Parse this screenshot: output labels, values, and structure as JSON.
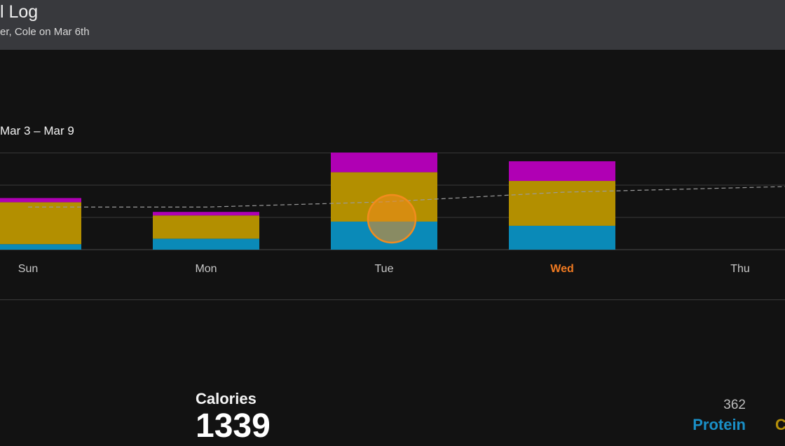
{
  "header": {
    "title": "l Log",
    "subtitle": "er, Cole on Mar 6th"
  },
  "week": {
    "range_label": "Mar 3 – Mar 9"
  },
  "colors": {
    "protein": "#0a8ab8",
    "carbs": "#b38f00",
    "fat": "#b000b4",
    "today": "#f07a21",
    "trend": "#9a9a9a",
    "selection": "#f28c1e"
  },
  "chart_data": {
    "type": "bar",
    "stacked": true,
    "categories": [
      "Sun",
      "Mon",
      "Tue",
      "Wed",
      "Thu"
    ],
    "highlighted_category": "Wed",
    "ylim": [
      0,
      1500
    ],
    "series": [
      {
        "name": "Protein",
        "values": [
          85,
          170,
          435,
          370,
          0
        ]
      },
      {
        "name": "",
        "values": [
          650,
          360,
          765,
          695,
          0
        ]
      },
      {
        "name": "",
        "values": [
          65,
          55,
          305,
          305,
          0
        ]
      }
    ],
    "trend_line": [
      660,
      660,
      740,
      890,
      960
    ],
    "selected_category": "Tue"
  },
  "summary": {
    "calories_label": "Calories",
    "calories_value": "1339",
    "protein_value": "362",
    "protein_label": "Protein",
    "next_label": "C"
  }
}
